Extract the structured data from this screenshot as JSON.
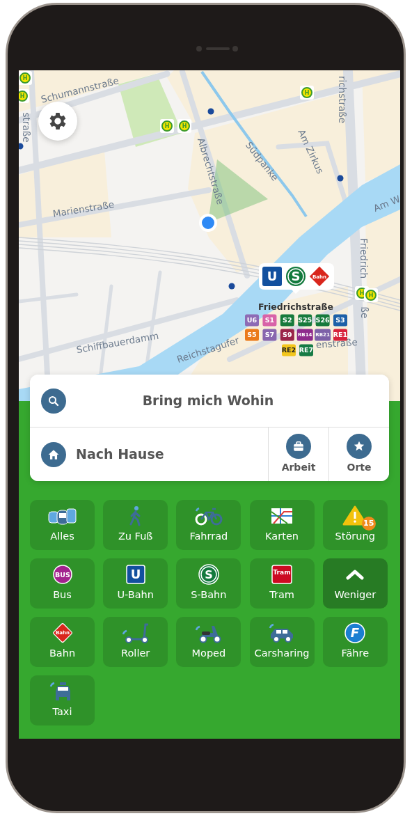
{
  "map": {
    "street_labels": [
      {
        "text": "straße"
      },
      {
        "text": "Schumannstraße"
      },
      {
        "text": "Albrechtstraße"
      },
      {
        "text": "Südpanke"
      },
      {
        "text": "Am Zirkus"
      },
      {
        "text": "richstraße"
      },
      {
        "text": "Marienstraße"
      },
      {
        "text": "Am W"
      },
      {
        "text": "Friedrich"
      },
      {
        "text": "ße"
      },
      {
        "text": "Schiffbauerdamm"
      },
      {
        "text": "Reichstagufer"
      },
      {
        "text": "enstraße"
      }
    ],
    "bus_stops": [
      {
        "label": "H"
      },
      {
        "label": "H"
      },
      {
        "label": "H"
      },
      {
        "label": "H"
      },
      {
        "label": "H"
      },
      {
        "label": "H"
      },
      {
        "label": "H"
      }
    ],
    "station": {
      "name": "Friedrichstraße",
      "symbols": [
        {
          "kind": "ubahn",
          "label": "U"
        },
        {
          "kind": "sbahn",
          "label": "S"
        },
        {
          "kind": "bahn",
          "label": "Bahn"
        }
      ],
      "lines": [
        {
          "label": "U6",
          "color": "#8d6bb5"
        },
        {
          "label": "S1",
          "color": "#d862a8"
        },
        {
          "label": "S2",
          "color": "#177a3c"
        },
        {
          "label": "S25",
          "color": "#177a3c"
        },
        {
          "label": "S26",
          "color": "#177a3c"
        },
        {
          "label": "S3",
          "color": "#1d60a8"
        },
        {
          "label": "S5",
          "color": "#eb7a1b"
        },
        {
          "label": "S7",
          "color": "#8966ae"
        },
        {
          "label": "S9",
          "color": "#9a2448"
        },
        {
          "label": "RB14",
          "color": "#8e2a8c"
        },
        {
          "label": "RB21",
          "color": "#7d61a8"
        },
        {
          "label": "RE1",
          "color": "#d7213a"
        },
        {
          "label": "RE2",
          "color": "#f3c61c"
        },
        {
          "label": "RE7",
          "color": "#167b45"
        }
      ]
    }
  },
  "search": {
    "label": "Bring mich Wohin"
  },
  "home": {
    "label": "Nach Hause"
  },
  "shortcuts": [
    {
      "kind": "work",
      "label": "Arbeit"
    },
    {
      "kind": "places",
      "label": "Orte"
    }
  ],
  "tiles": [
    {
      "kind": "all",
      "label": "Alles"
    },
    {
      "kind": "walk",
      "label": "Zu Fuß"
    },
    {
      "kind": "bike",
      "label": "Fahrrad"
    },
    {
      "kind": "maps",
      "label": "Karten"
    },
    {
      "kind": "alert",
      "label": "Störung",
      "badge": "15"
    },
    {
      "kind": "bus",
      "label": "Bus",
      "icon_text": "BUS"
    },
    {
      "kind": "ubahn",
      "label": "U-Bahn",
      "icon_text": "U"
    },
    {
      "kind": "sbahn",
      "label": "S-Bahn",
      "icon_text": "S"
    },
    {
      "kind": "tram",
      "label": "Tram",
      "icon_text": "Tram"
    },
    {
      "kind": "less",
      "label": "Weniger"
    },
    {
      "kind": "bahn",
      "label": "Bahn",
      "icon_text": "Bahn"
    },
    {
      "kind": "scooter",
      "label": "Roller"
    },
    {
      "kind": "moped",
      "label": "Moped"
    },
    {
      "kind": "car",
      "label": "Carsharing"
    },
    {
      "kind": "ferry",
      "label": "Fähre",
      "icon_text": "F"
    },
    {
      "kind": "taxi",
      "label": "Taxi"
    }
  ]
}
